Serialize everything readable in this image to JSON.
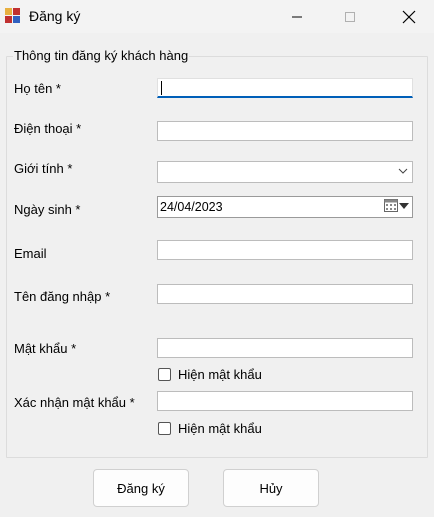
{
  "window": {
    "title": "Đăng ký"
  },
  "group": {
    "title": "Thông tin đăng ký khách hàng"
  },
  "fields": {
    "ho_ten": {
      "label": "Họ tên *",
      "value": ""
    },
    "dien_thoai": {
      "label": "Điện thoại *",
      "value": ""
    },
    "gioi_tinh": {
      "label": "Giới tính *",
      "value": ""
    },
    "ngay_sinh": {
      "label": "Ngày sinh *",
      "value": "24/04/2023"
    },
    "email": {
      "label": "Email",
      "value": ""
    },
    "ten_dang_nhap": {
      "label": "Tên đăng nhập *",
      "value": ""
    },
    "mat_khau": {
      "label": "Mật khẩu *",
      "value": ""
    },
    "xac_nhan_mat_khau": {
      "label": "Xác nhận mật khẩu *",
      "value": ""
    }
  },
  "checkboxes": {
    "show_password": {
      "label": "Hiện mật khẩu",
      "checked": false
    },
    "show_confirm_password": {
      "label": "Hiện mật khẩu",
      "checked": false
    }
  },
  "buttons": {
    "register": "Đăng ký",
    "cancel": "Hủy"
  },
  "icons": {
    "app": "app-icon",
    "minimize": "minimize-icon",
    "maximize": "maximize-icon",
    "close": "close-icon",
    "dropdown": "chevron-down-icon",
    "calendar": "calendar-icon"
  },
  "colors": {
    "focus_underline": "#005fb8",
    "window_background": "#f0f0f0"
  }
}
